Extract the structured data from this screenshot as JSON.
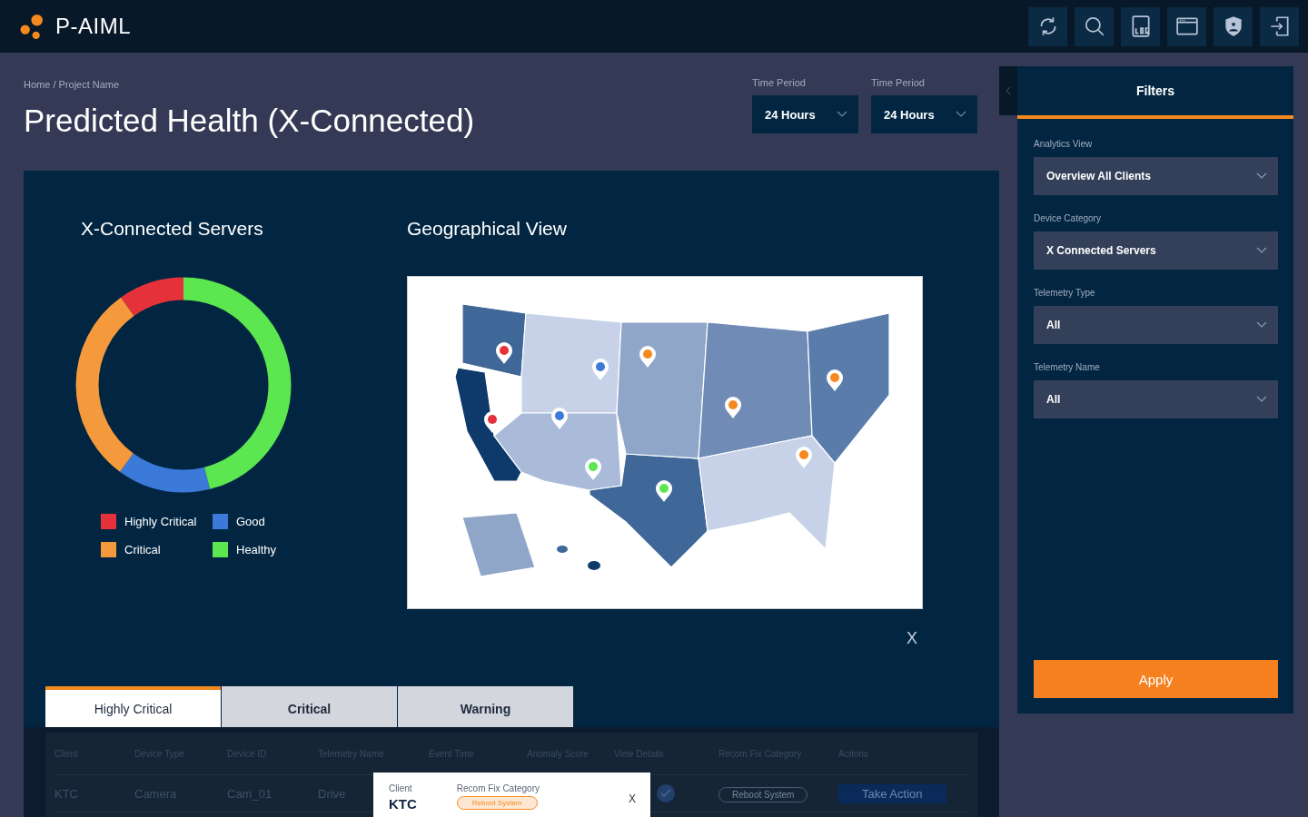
{
  "app": {
    "name": "P-AIML"
  },
  "toolbar": [
    {
      "kind": "refresh"
    },
    {
      "kind": "search"
    },
    {
      "kind": "log"
    },
    {
      "kind": "window"
    },
    {
      "kind": "shield"
    },
    {
      "kind": "logout"
    }
  ],
  "breadcrumb": "Home / Project Name",
  "title": "Predicted Health (X-Connected)",
  "time_filters": [
    {
      "label": "Time Period",
      "value": "24 Hours"
    },
    {
      "label": "Time Period",
      "value": "24 Hours"
    }
  ],
  "donut": {
    "title": "X-Connected Servers",
    "legend": [
      {
        "label": "Highly Critical",
        "color": "#e5323a"
      },
      {
        "label": "Good",
        "color": "#3b7ad8"
      },
      {
        "label": "Critical",
        "color": "#f59a3c"
      },
      {
        "label": "Healthy",
        "color": "#5ce64f"
      }
    ]
  },
  "geo": {
    "title": "Geographical View",
    "close": "X",
    "pins": [
      {
        "color": "#e5323a"
      },
      {
        "color": "#3b7ad8"
      },
      {
        "color": "#f5891f"
      },
      {
        "color": "#e5323a"
      },
      {
        "color": "#3b7ad8"
      },
      {
        "color": "#f5891f"
      },
      {
        "color": "#f5891f"
      },
      {
        "color": "#5ce64f"
      },
      {
        "color": "#5ce64f"
      },
      {
        "color": "#f5891f"
      }
    ]
  },
  "tabs": [
    {
      "label": "Highly Critical",
      "selected": true
    },
    {
      "label": "Critical",
      "selected": false
    },
    {
      "label": "Warning",
      "selected": false
    }
  ],
  "table": {
    "columns": [
      "Client",
      "Device Type",
      "Device ID",
      "Telemetry Name",
      "Event Time",
      "Anomaly Score",
      "View Details",
      "Recom Fix Category",
      "Actions"
    ],
    "row": {
      "client": "KTC",
      "device_type": "Camera",
      "device_id": "Cam_01",
      "telemetry": "Drive",
      "fix": "Reboot System",
      "action": "Take Action"
    }
  },
  "popup": {
    "client_label": "Client",
    "fix_label": "Recom Fix Category",
    "close": "X",
    "client": "KTC",
    "fix": "Reboot System"
  },
  "filters": {
    "title": "Filters",
    "fields": [
      {
        "label": "Analytics View",
        "value": "Overview All Clients"
      },
      {
        "label": "Device Category",
        "value": "X Connected Servers"
      },
      {
        "label": "Telemetry Type",
        "value": "All"
      },
      {
        "label": "Telemetry Name",
        "value": "All"
      }
    ],
    "apply": "Apply"
  }
}
